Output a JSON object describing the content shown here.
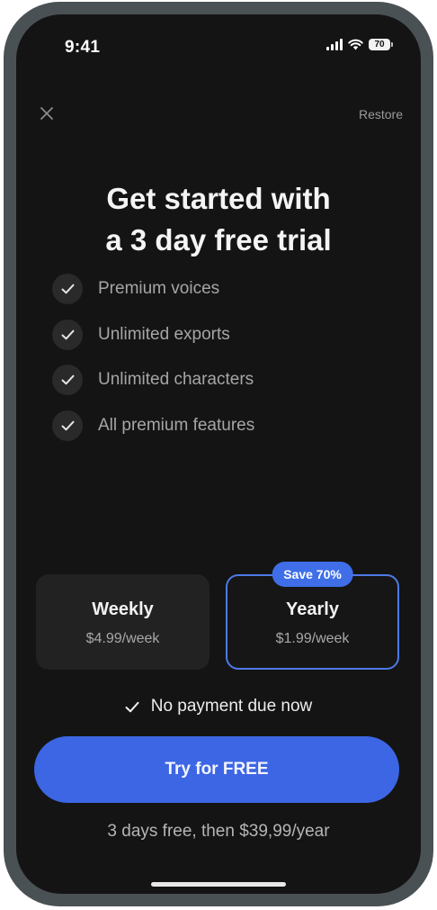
{
  "status_bar": {
    "time": "9:41",
    "battery": "70",
    "icons": [
      "signal-icon",
      "wifi-icon",
      "battery-icon"
    ]
  },
  "top_bar": {
    "close_icon": "close-icon",
    "restore_label": "Restore"
  },
  "headline": {
    "line1": "Get started with",
    "line2": "a 3 day free trial"
  },
  "features": [
    {
      "label": "Premium voices",
      "icon": "checkmark-icon"
    },
    {
      "label": "Unlimited exports",
      "icon": "checkmark-icon"
    },
    {
      "label": "Unlimited characters",
      "icon": "checkmark-icon"
    },
    {
      "label": "All premium features",
      "icon": "checkmark-icon"
    }
  ],
  "plans": {
    "weekly": {
      "name": "Weekly",
      "price": "$4.99/week",
      "selected": false
    },
    "yearly": {
      "name": "Yearly",
      "price": "$1.99/week",
      "badge": "Save 70%",
      "selected": true
    }
  },
  "no_payment": "No payment due now",
  "cta_label": "Try for FREE",
  "trial_note": "3 days free, then $39,99/year",
  "colors": {
    "background": "#141414",
    "accent": "#3c66e4",
    "frame": "#4a5154"
  }
}
